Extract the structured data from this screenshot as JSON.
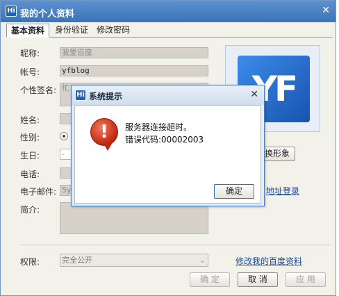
{
  "window": {
    "title": "我的个人资料",
    "logo": "Hi",
    "close_glyph": "✕"
  },
  "tabs": [
    {
      "label": "基本资料"
    },
    {
      "label": "身份验证"
    },
    {
      "label": "修改密码"
    }
  ],
  "form": {
    "nickname": {
      "label": "昵称:",
      "value": "我爱百度"
    },
    "account": {
      "label": "帐号:",
      "value": "yfblog"
    },
    "signature": {
      "label": "个性签名:",
      "value": "忙"
    },
    "name": {
      "label": "姓名:"
    },
    "gender": {
      "label": "性别:"
    },
    "birthday": {
      "label": "生日:",
      "value": "-"
    },
    "phone": {
      "label": "电话:"
    },
    "email": {
      "label": "电子邮件:",
      "value": "5y"
    },
    "intro": {
      "label": "简介:"
    },
    "permission": {
      "label": "权限:",
      "value": "完全公开"
    }
  },
  "avatar": {
    "text": "YF",
    "change_button_partial": "换形象"
  },
  "login_link_partial": "地址登录",
  "edit_profile_link": "修改我的百度资料",
  "buttons": {
    "ok": "确 定",
    "cancel": "取 消",
    "apply": "应 用"
  },
  "dialog": {
    "title": "系统提示",
    "logo": "Hi",
    "close_glyph": "✕",
    "icon": "error-icon",
    "icon_glyph": "!",
    "line1": "服务器连接超时。",
    "line2": "错误代码:00002003",
    "ok_button": "确定"
  }
}
